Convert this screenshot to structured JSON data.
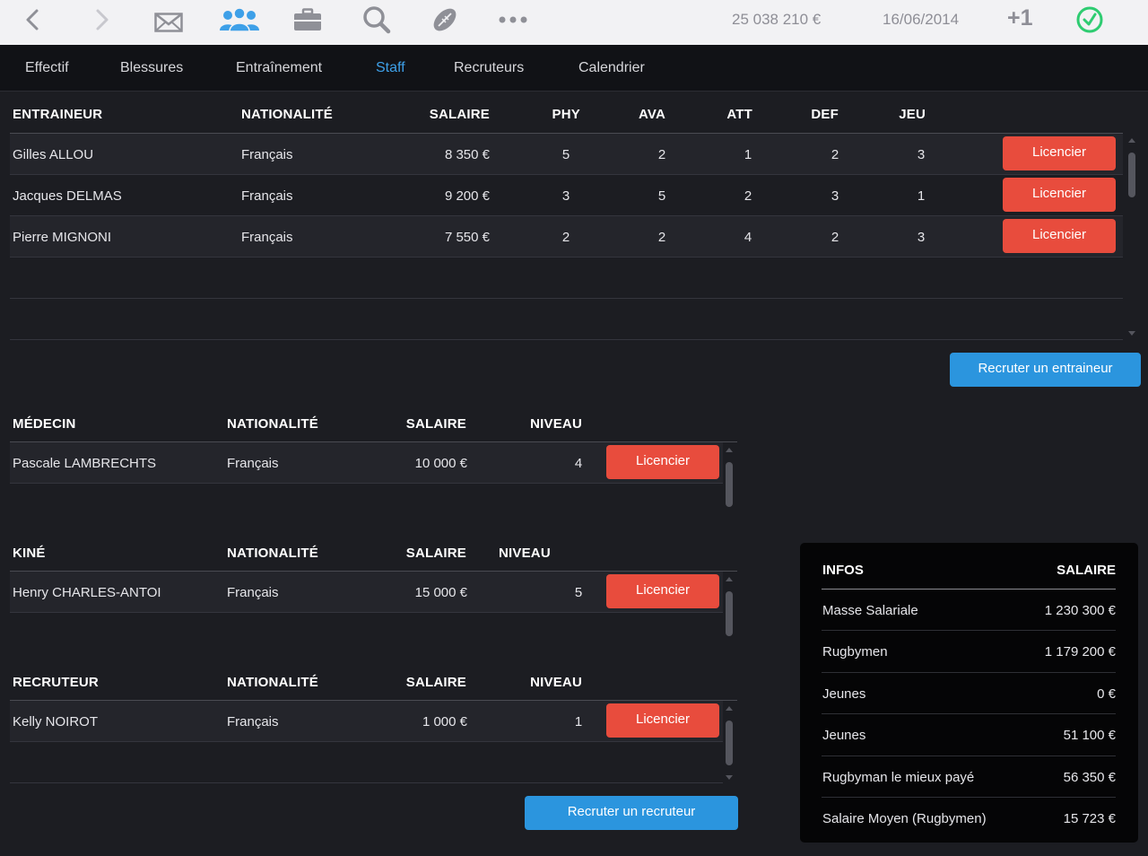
{
  "topbar": {
    "icons": [
      "back-arrow-icon",
      "forward-arrow-icon",
      "mail-icon",
      "team-icon",
      "briefcase-icon",
      "search-icon",
      "rugby-ball-icon",
      "more-icon",
      "check-clock-icon"
    ],
    "budget": "25 038 210 €",
    "date": "16/06/2014",
    "plus_one": "+1",
    "accent_color": "#3ea0e8",
    "check_color": "#2ecc71"
  },
  "tabs": [
    {
      "label": "Effectif"
    },
    {
      "label": "Blessures"
    },
    {
      "label": "Entraînement"
    },
    {
      "label": "Staff"
    },
    {
      "label": "Recruteurs"
    },
    {
      "label": "Calendrier"
    }
  ],
  "active_tab": "Staff",
  "coaches": {
    "headers": {
      "name": "ENTRAINEUR",
      "nat": "NATIONALITÉ",
      "salary": "SALAIRE",
      "phy": "PHY",
      "ava": "AVA",
      "att": "ATT",
      "def": "DEF",
      "jeu": "JEU"
    },
    "rows": [
      {
        "name": "Gilles ALLOU",
        "nat": "Français",
        "salary": "8 350 €",
        "phy": "5",
        "ava": "2",
        "att": "1",
        "def": "2",
        "jeu": "3",
        "action": "Licencier"
      },
      {
        "name": "Jacques DELMAS",
        "nat": "Français",
        "salary": "9 200 €",
        "phy": "3",
        "ava": "5",
        "att": "2",
        "def": "3",
        "jeu": "1",
        "action": "Licencier"
      },
      {
        "name": "Pierre MIGNONI",
        "nat": "Français",
        "salary": "7 550 €",
        "phy": "2",
        "ava": "2",
        "att": "4",
        "def": "2",
        "jeu": "3",
        "action": "Licencier"
      }
    ],
    "recruit_button": "Recruter un entraineur"
  },
  "doctor": {
    "headers": {
      "name": "MÉDECIN",
      "nat": "NATIONALITÉ",
      "salary": "SALAIRE",
      "level": "NIVEAU"
    },
    "rows": [
      {
        "name": "Pascale LAMBRECHTS",
        "nat": "Français",
        "salary": "10 000 €",
        "level": "4",
        "action": "Licencier"
      }
    ]
  },
  "physio": {
    "headers": {
      "name": "KINÉ",
      "nat": "NATIONALITÉ",
      "salary": "SALAIRE",
      "level": "NIVEAU"
    },
    "rows": [
      {
        "name": "Henry CHARLES-ANTOI",
        "nat": "Français",
        "salary": "15 000 €",
        "level": "5",
        "action": "Licencier"
      }
    ]
  },
  "scout": {
    "headers": {
      "name": "RECRUTEUR",
      "nat": "NATIONALITÉ",
      "salary": "SALAIRE",
      "level": "NIVEAU"
    },
    "rows": [
      {
        "name": "Kelly NOIROT",
        "nat": "Français",
        "salary": "1 000 €",
        "level": "1",
        "action": "Licencier"
      }
    ],
    "recruit_button": "Recruter un recruteur"
  },
  "infos": {
    "header_label": "INFOS",
    "header_value": "SALAIRE",
    "rows": [
      {
        "label": "Masse Salariale",
        "value": "1 230 300 €"
      },
      {
        "label": "Rugbymen",
        "value": "1 179 200 €"
      },
      {
        "label": "Jeunes",
        "value": "0 €"
      },
      {
        "label": "Jeunes",
        "value": "51 100 €"
      },
      {
        "label": "Rugbyman le mieux payé",
        "value": "56 350 €"
      },
      {
        "label": "Salaire Moyen (Rugbymen)",
        "value": "15 723 €"
      }
    ]
  },
  "colors": {
    "danger": "#e84c3d",
    "primary": "#2b95de",
    "background": "#1c1d22",
    "panel": "#050506"
  }
}
